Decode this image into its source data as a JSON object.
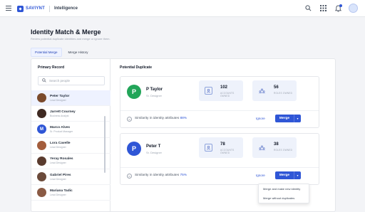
{
  "header": {
    "logo_text": "SAVIYNT",
    "product": "Intelligence",
    "icons": [
      "search-icon",
      "apps-grid-icon",
      "notification-icon",
      "user-avatar"
    ]
  },
  "page": {
    "title": "Identity Match & Merge",
    "subtitle": "Review potential duplicate identities and merge or ignore them.",
    "tabs": [
      {
        "label": "Potential Merge",
        "active": true
      },
      {
        "label": "Merge History",
        "active": false
      }
    ]
  },
  "primary": {
    "title": "Primary Record",
    "search_placeholder": "Search people",
    "items": [
      {
        "name": "Peter Taylor",
        "role": "Lead Designer",
        "selected": true,
        "avatar_color": "#7a4a2c",
        "initial": ""
      },
      {
        "name": "Jarrett Courney",
        "role": "Business Analyst",
        "selected": false,
        "avatar_color": "#3f2a22",
        "initial": ""
      },
      {
        "name": "Marco Alves",
        "role": "Sr. Product Manager",
        "selected": false,
        "avatar_color": "#2f56d6",
        "initial": "M"
      },
      {
        "name": "Lora Cavelle",
        "role": "Lead Designer",
        "selected": false,
        "avatar_color": "#a35d3c",
        "initial": ""
      },
      {
        "name": "Yeray Rosales",
        "role": "Lead Designer",
        "selected": false,
        "avatar_color": "#5a3b2e",
        "initial": ""
      },
      {
        "name": "Gabriel Pires",
        "role": "Lead Designer",
        "selected": false,
        "avatar_color": "#6b4a3a",
        "initial": ""
      },
      {
        "name": "Mariana Tadic",
        "role": "Lead Designer",
        "selected": false,
        "avatar_color": "#8a5a44",
        "initial": ""
      }
    ]
  },
  "duplicates": {
    "title": "Potential Duplicate",
    "cards": [
      {
        "initial": "P",
        "avatar_color": "#22a559",
        "name": "P Taylor",
        "role": "Sr. Designer",
        "stat1_value": "102",
        "stat1_label": "ACCOUNTS OWNED",
        "stat2_value": "56",
        "stat2_label": "ROLES OWNED",
        "similarity_text": "Similarity in identity attributes",
        "similarity_pct": "88%",
        "ignore": "Ignore",
        "merge": "Merge"
      },
      {
        "initial": "P",
        "avatar_color": "#2f56d6",
        "name": "Peter T",
        "role": "Sr. Designer",
        "stat1_value": "78",
        "stat1_label": "ACCOUNTS OWNED",
        "stat2_value": "38",
        "stat2_label": "ROLES OWNED",
        "similarity_text": "Similarity in identity attributes",
        "similarity_pct": "75%",
        "ignore": "Ignore",
        "merge": "Merge"
      }
    ]
  },
  "dropdown": {
    "items": [
      "Merge and make new identity",
      "Merge without duplicates"
    ]
  },
  "colors": {
    "accent": "#2f56d6",
    "success": "#22a559",
    "selected_bg": "#eef2ff"
  }
}
